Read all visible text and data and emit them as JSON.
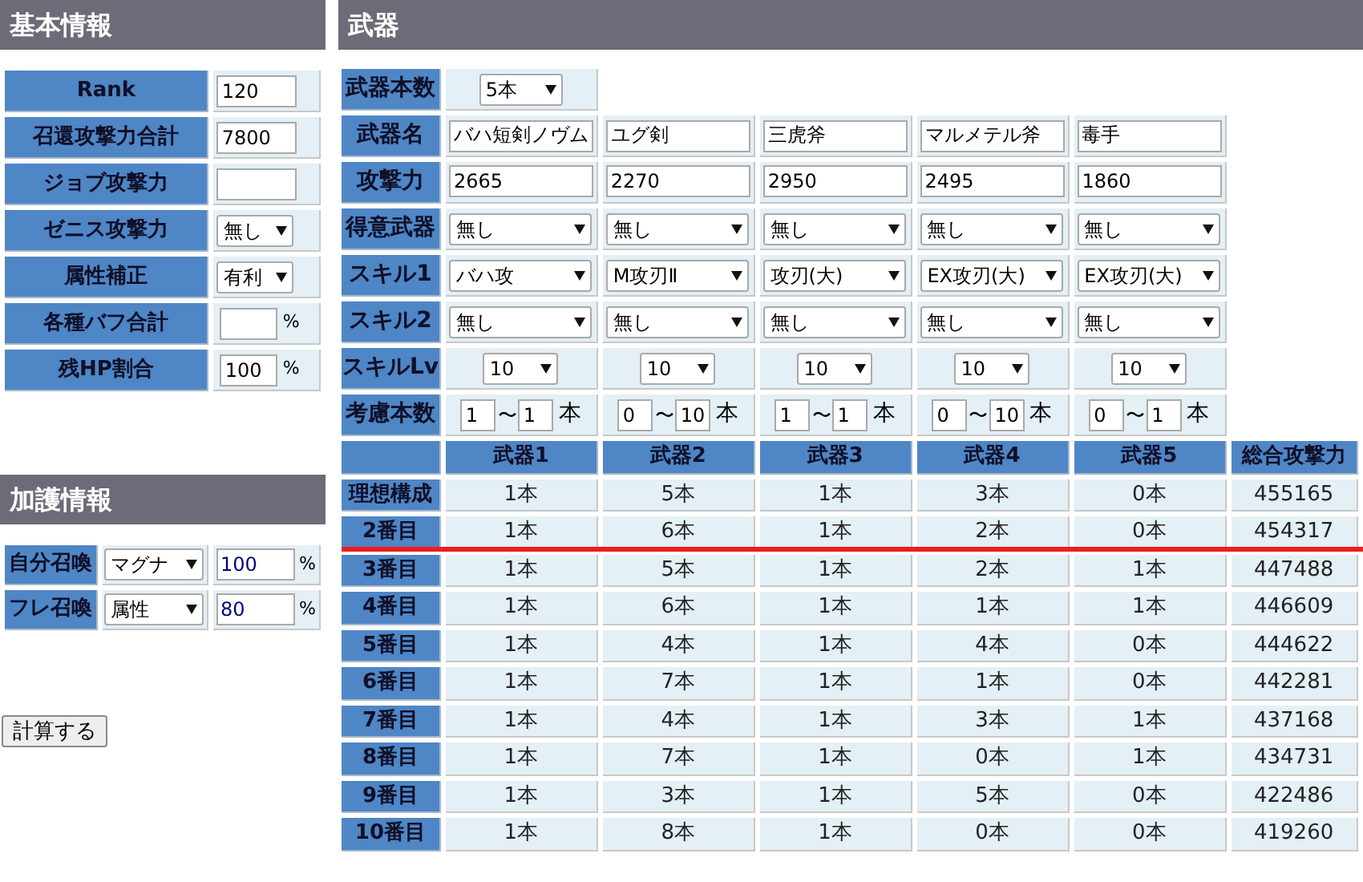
{
  "basic": {
    "title": "基本情報",
    "rows": [
      {
        "label": "Rank",
        "kind": "input",
        "value": "120"
      },
      {
        "label": "召還攻撃力合計",
        "kind": "input",
        "value": "7800"
      },
      {
        "label": "ジョブ攻撃力",
        "kind": "input",
        "value": ""
      },
      {
        "label": "ゼニス攻撃力",
        "kind": "select",
        "value": "無し"
      },
      {
        "label": "属性補正",
        "kind": "select",
        "value": "有利"
      },
      {
        "label": "各種バフ合計",
        "kind": "percent",
        "value": "",
        "unit": "%"
      },
      {
        "label": "残HP割合",
        "kind": "percent",
        "value": "100",
        "unit": "%"
      }
    ]
  },
  "blessing": {
    "title": "加護情報",
    "rows": [
      {
        "label": "自分召喚",
        "type": "マグナ",
        "value": "100",
        "unit": "%"
      },
      {
        "label": "フレ召喚",
        "type": "属性",
        "value": "80",
        "unit": "%"
      }
    ]
  },
  "calc_button": "計算する",
  "weapons": {
    "title": "武器",
    "count_label": "武器本数",
    "count": "5本",
    "labels": {
      "name": "武器名",
      "attack": "攻撃力",
      "specialty": "得意武器",
      "skill1": "スキル1",
      "skill2": "スキル2",
      "skill_lv": "スキルLv",
      "range": "考慮本数"
    },
    "items": [
      {
        "name": "バハ短剣ノヴム",
        "attack": "2665",
        "specialty": "無し",
        "skill1": "バハ攻",
        "skill2": "無し",
        "skill_lv": "10",
        "min": "1",
        "sep": "〜",
        "max": "1",
        "unit": "本"
      },
      {
        "name": "ユグ剣",
        "attack": "2270",
        "specialty": "無し",
        "skill1": "M攻刃Ⅱ",
        "skill2": "無し",
        "skill_lv": "10",
        "min": "0",
        "sep": "〜",
        "max": "10",
        "unit": "本"
      },
      {
        "name": "三虎斧",
        "attack": "2950",
        "specialty": "無し",
        "skill1": "攻刃(大)",
        "skill2": "無し",
        "skill_lv": "10",
        "min": "1",
        "sep": "〜",
        "max": "1",
        "unit": "本"
      },
      {
        "name": "マルメテル斧",
        "attack": "2495",
        "specialty": "無し",
        "skill1": "EX攻刃(大)",
        "skill2": "無し",
        "skill_lv": "10",
        "min": "0",
        "sep": "〜",
        "max": "10",
        "unit": "本"
      },
      {
        "name": "毒手",
        "attack": "1860",
        "specialty": "無し",
        "skill1": "EX攻刃(大)",
        "skill2": "無し",
        "skill_lv": "10",
        "min": "0",
        "sep": "〜",
        "max": "1",
        "unit": "本"
      }
    ]
  },
  "results": {
    "columns": [
      "武器1",
      "武器2",
      "武器3",
      "武器4",
      "武器5",
      "総合攻撃力"
    ],
    "rows": [
      {
        "label": "理想構成",
        "cells": [
          "1本",
          "5本",
          "1本",
          "3本",
          "0本",
          "455165"
        ]
      },
      {
        "label": "2番目",
        "cells": [
          "1本",
          "6本",
          "1本",
          "2本",
          "0本",
          "454317"
        ]
      },
      {
        "label": "3番目",
        "cells": [
          "1本",
          "5本",
          "1本",
          "2本",
          "1本",
          "447488"
        ]
      },
      {
        "label": "4番目",
        "cells": [
          "1本",
          "6本",
          "1本",
          "1本",
          "1本",
          "446609"
        ]
      },
      {
        "label": "5番目",
        "cells": [
          "1本",
          "4本",
          "1本",
          "4本",
          "0本",
          "444622"
        ]
      },
      {
        "label": "6番目",
        "cells": [
          "1本",
          "7本",
          "1本",
          "1本",
          "0本",
          "442281"
        ]
      },
      {
        "label": "7番目",
        "cells": [
          "1本",
          "4本",
          "1本",
          "3本",
          "1本",
          "437168"
        ]
      },
      {
        "label": "8番目",
        "cells": [
          "1本",
          "7本",
          "1本",
          "0本",
          "1本",
          "434731"
        ]
      },
      {
        "label": "9番目",
        "cells": [
          "1本",
          "3本",
          "1本",
          "5本",
          "0本",
          "422486"
        ]
      },
      {
        "label": "10番目",
        "cells": [
          "1本",
          "8本",
          "1本",
          "0本",
          "0本",
          "419260"
        ]
      }
    ]
  }
}
